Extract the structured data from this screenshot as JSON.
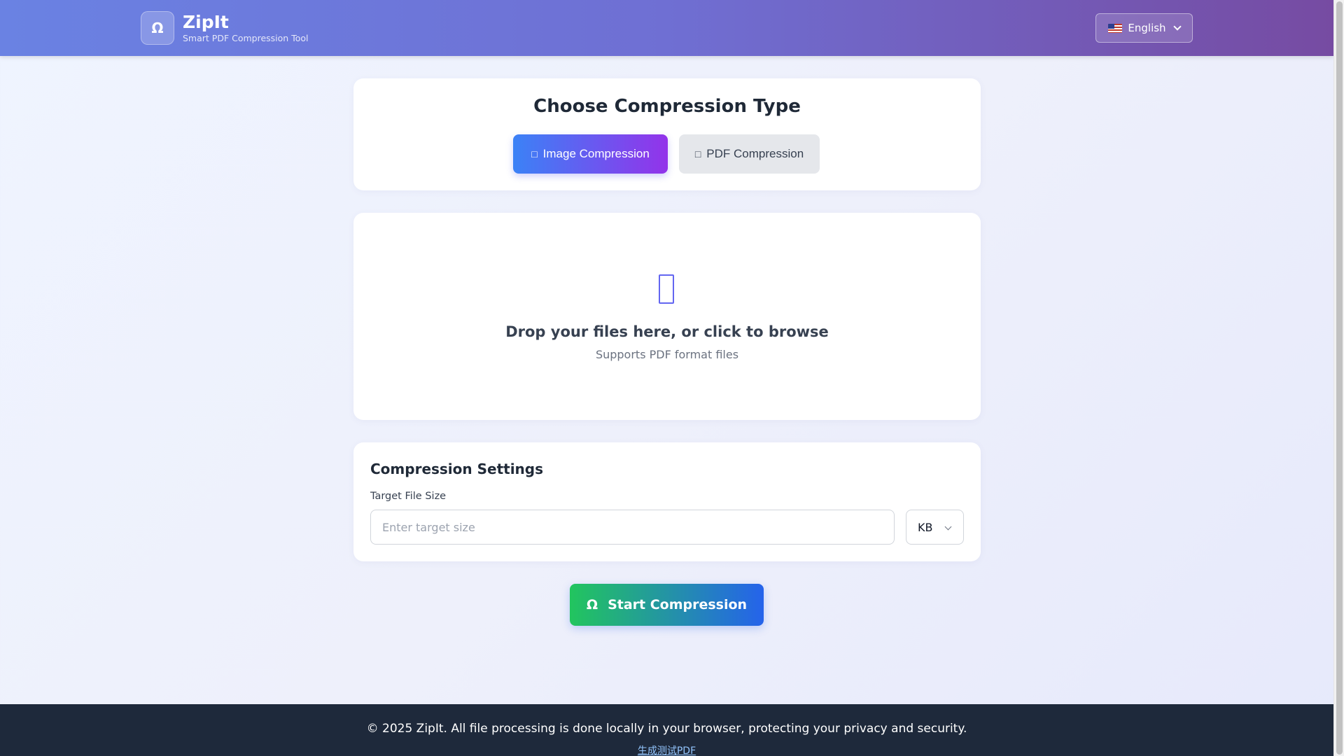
{
  "header": {
    "logo_glyph": "Ω",
    "title": "ZipIt",
    "subtitle": "Smart PDF Compression Tool",
    "language": {
      "label": "English",
      "icon": "us-flag-icon"
    }
  },
  "type_card": {
    "title": "Choose Compression Type",
    "options": [
      {
        "label": "Image Compression",
        "icon": "image-icon",
        "active": true
      },
      {
        "label": "PDF Compression",
        "icon": "pdf-icon",
        "active": false
      }
    ]
  },
  "dropzone": {
    "icon": "upload-icon",
    "title": "Drop your files here, or click to browse",
    "subtitle": "Supports PDF format files"
  },
  "settings": {
    "title": "Compression Settings",
    "target_label": "Target File Size",
    "target_placeholder": "Enter target size",
    "target_value": "",
    "unit": "KB"
  },
  "actions": {
    "start_glyph": "Ω",
    "start_label": "Start Compression"
  },
  "footer": {
    "text": "© 2025 ZipIt. All file processing is done locally in your browser, protecting your privacy and security.",
    "link": "生成测试PDF"
  },
  "colors": {
    "header_start": "#6a82e3",
    "header_end": "#764ba2",
    "active_start": "#3b82f6",
    "active_end": "#9333ea",
    "start_btn_start": "#22c55e",
    "start_btn_end": "#2563eb",
    "footer_bg": "#1e293b"
  }
}
